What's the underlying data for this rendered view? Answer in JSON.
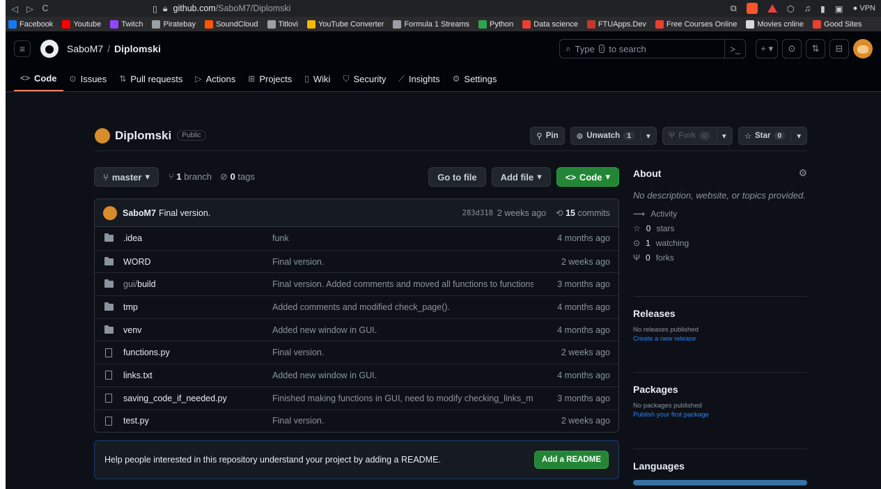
{
  "browser": {
    "url_host": "github.com",
    "url_path": "/SaboM7/Diplomski",
    "vpn_label": "VPN"
  },
  "bookmarks": [
    {
      "label": "Facebook",
      "color": "#1877f2"
    },
    {
      "label": "Youtube",
      "color": "#ff0000"
    },
    {
      "label": "Twitch",
      "color": "#9146ff"
    },
    {
      "label": "Piratebay",
      "color": "#9aa0a6"
    },
    {
      "label": "SoundCloud",
      "color": "#ff5500"
    },
    {
      "label": "Titlovi",
      "color": "#9aa0a6"
    },
    {
      "label": "YouTube Converter",
      "color": "#f2b705"
    },
    {
      "label": "Formula 1 Streams",
      "color": "#9aa0a6"
    },
    {
      "label": "Python",
      "color": "#2da44e"
    },
    {
      "label": "Data science",
      "color": "#e8402f"
    },
    {
      "label": "FTUApps.Dev",
      "color": "#c0392b"
    },
    {
      "label": "Free Courses Online",
      "color": "#e8402f"
    },
    {
      "label": "Movies cnline",
      "color": "#d9d9d9"
    },
    {
      "label": "Good Sites",
      "color": "#e8402f"
    }
  ],
  "header": {
    "owner": "SaboM7",
    "separator": "/",
    "repo": "Diplomski",
    "search_pre": "Type",
    "search_key": "/",
    "search_post": "to search"
  },
  "tabs": [
    {
      "label": "Code",
      "icon": "<>"
    },
    {
      "label": "Issues",
      "icon": "⊙"
    },
    {
      "label": "Pull requests",
      "icon": "⇅"
    },
    {
      "label": "Actions",
      "icon": "▷"
    },
    {
      "label": "Projects",
      "icon": "⊞"
    },
    {
      "label": "Wiki",
      "icon": "▯"
    },
    {
      "label": "Security",
      "icon": "⛉"
    },
    {
      "label": "Insights",
      "icon": "⟋"
    },
    {
      "label": "Settings",
      "icon": "⚙"
    }
  ],
  "repo": {
    "name": "Diplomski",
    "visibility": "Public",
    "pin": "Pin",
    "unwatch": "Unwatch",
    "watch_count": "1",
    "fork": "Fork",
    "fork_count": "0",
    "star": "Star",
    "star_count": "0"
  },
  "branch": {
    "name": "master",
    "branch_count": "1",
    "branch_label": "branch",
    "tag_count": "0",
    "tag_label": "tags",
    "go_to_file": "Go to file",
    "add_file": "Add file",
    "code": "Code"
  },
  "commit": {
    "user": "SaboM7",
    "message": "Final version.",
    "hash": "283d318",
    "age": "2 weeks ago",
    "count": "15",
    "count_label": "commits"
  },
  "files": [
    {
      "type": "dir",
      "name": ".idea",
      "prefix": "",
      "message": "funk",
      "age": "4 months ago"
    },
    {
      "type": "dir",
      "name": "WORD",
      "prefix": "",
      "message": "Final version.",
      "age": "2 weeks ago"
    },
    {
      "type": "dir",
      "name": "build",
      "prefix": "gui/",
      "message": "Final version. Added comments and moved all functions to functions.py.",
      "age": "3 months ago"
    },
    {
      "type": "dir",
      "name": "tmp",
      "prefix": "",
      "message": "Added comments and modified check_page().",
      "age": "4 months ago"
    },
    {
      "type": "dir",
      "name": "venv",
      "prefix": "",
      "message": "Added new window in GUI.",
      "age": "4 months ago"
    },
    {
      "type": "file",
      "name": "functions.py",
      "prefix": "",
      "message": "Final version.",
      "age": "2 weeks ago"
    },
    {
      "type": "file",
      "name": "links.txt",
      "prefix": "",
      "message": "Added new window in GUI.",
      "age": "4 months ago"
    },
    {
      "type": "file",
      "name": "saving_code_if_needed.py",
      "prefix": "",
      "message": "Finished making functions in GUI, need to modify checking_links_makin...",
      "age": "3 months ago"
    },
    {
      "type": "file",
      "name": "test.py",
      "prefix": "",
      "message": "Final version.",
      "age": "2 weeks ago"
    }
  ],
  "readme": {
    "text": "Help people interested in this repository understand your project by adding a README.",
    "button": "Add a README"
  },
  "sidebar": {
    "about_title": "About",
    "description": "No description, website, or topics provided.",
    "activity": "Activity",
    "stars_count": "0",
    "stars_label": "stars",
    "watching_count": "1",
    "watching_label": "watching",
    "forks_count": "0",
    "forks_label": "forks",
    "releases_title": "Releases",
    "releases_text": "No releases published",
    "releases_link": "Create a new release",
    "packages_title": "Packages",
    "packages_text": "No packages published",
    "packages_link": "Publish your first package",
    "languages_title": "Languages"
  },
  "colors": {
    "accent_green": "#238636",
    "link_blue": "#2f81f7",
    "active_tab": "#f78166"
  }
}
